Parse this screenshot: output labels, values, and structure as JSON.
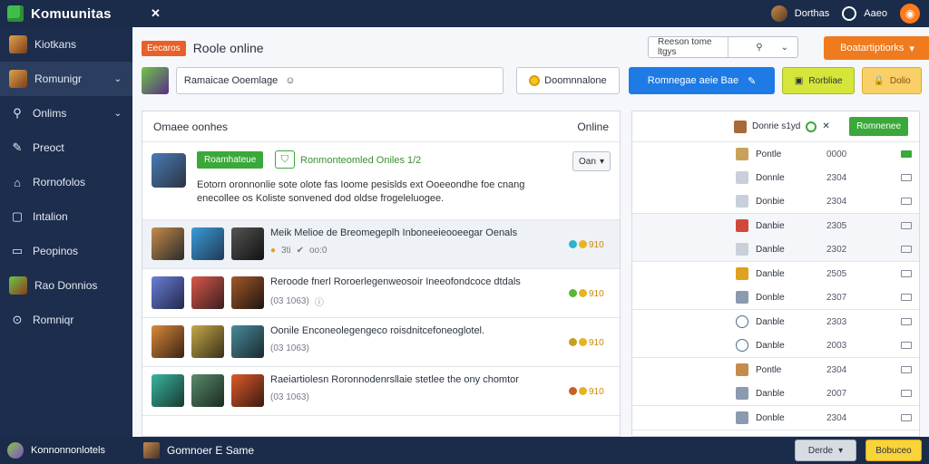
{
  "topbar": {
    "title": "Komuunitas",
    "user1": "Dorthas",
    "user2": "Aaeo",
    "close_icon": "close-icon",
    "notify_icon": "bell-icon"
  },
  "sidebar": {
    "items": [
      {
        "label": "Kiotkans",
        "icon": "avatar-thumb"
      },
      {
        "label": "Romunigr",
        "icon": "avatar-thumb",
        "active": true,
        "chev": "⌄"
      },
      {
        "label": "Onlims",
        "icon": "search-icon",
        "chev": "⌄"
      },
      {
        "label": "Preoct",
        "icon": "edit-icon"
      },
      {
        "label": "Rornofolos",
        "icon": "home-icon"
      },
      {
        "label": "Intalion",
        "icon": "square-icon"
      },
      {
        "label": "Peopinos",
        "icon": "chat-icon"
      },
      {
        "label": "Rao Donnios",
        "icon": "avatar-thumb"
      },
      {
        "label": "Romniqr",
        "icon": "settings-icon"
      }
    ]
  },
  "header": {
    "tag": "Eecaros",
    "title": "Roole online",
    "search_text": "Reeson tome ltgys",
    "search_icon": "search-icon",
    "action_button": "Boatartiptiorks"
  },
  "toolbar": {
    "input_value": "Ramaicae Ooemlage",
    "coin_button": "Doomnnalone",
    "blue_button": "Romnegae aeie Bae",
    "yg_button": "Rorbliae",
    "y_button": "Dolio"
  },
  "feed": {
    "head_left": "Omaee oonhes",
    "head_right": "Online",
    "post": {
      "tag": "Roamhateue",
      "title": "Ronmonteomled Oniles 1/2",
      "body": "Eotorn oronnonlie sote olote fas Ioome pesislds ext Ooeeondhe foe cnang enecollee os Koliste sonvened dod oldse frogeleluogee.",
      "dropdown": "Oan"
    },
    "threads": [
      {
        "title": "Meik Melioe de Breomegeplh Inboneeieooeegar Oenals",
        "meta": "3ti",
        "meta2": "oo:0",
        "gems": "910",
        "highlight": true
      },
      {
        "title": "Reroode fnerl Roroerlegenweosoir Ineeofondcoce dtdals",
        "meta": "(03 1063)",
        "meta2": "",
        "gems": "910"
      },
      {
        "title": "Oonile Enconeolegengeco roisdnitcefoneoglotel.",
        "meta": "(03 1063)",
        "meta2": "",
        "gems": "910"
      },
      {
        "title": "Raeiartiolesn Roronnodenrsllaie stetlee the ony chomtor",
        "meta": "(03 1063)",
        "meta2": "",
        "gems": "910"
      }
    ]
  },
  "rpanel": {
    "head_label": "Donrie s1yd",
    "head_button": "Romnenee",
    "groups": [
      {
        "rows": [
          {
            "name": "Pontle",
            "value": "0000",
            "on": true
          },
          {
            "name": "Donnle",
            "value": "2304"
          },
          {
            "name": "Donbie",
            "value": "2304"
          }
        ]
      },
      {
        "rows": [
          {
            "name": "Danbie",
            "value": "2305"
          },
          {
            "name": "Danble",
            "value": "2302"
          }
        ],
        "highlight": true
      },
      {
        "rows": [
          {
            "name": "Danble",
            "value": "2505"
          },
          {
            "name": "Donble",
            "value": "2307"
          }
        ]
      },
      {
        "rows": [
          {
            "name": "Danble",
            "value": "2303"
          },
          {
            "name": "Danble",
            "value": "2003"
          }
        ]
      },
      {
        "rows": [
          {
            "name": "Pontle",
            "value": "2304"
          },
          {
            "name": "Danble",
            "value": "2007"
          }
        ]
      },
      {
        "rows": [
          {
            "name": "Donble",
            "value": "2304"
          }
        ]
      }
    ]
  },
  "bottombar": {
    "left": "Konnonnonlotels",
    "mid": "Gomnoer E Same",
    "btn1": "Derde",
    "btn2": "Bobuceo"
  },
  "colors": {
    "nav": "#1b2b4a",
    "accent_orange": "#f07a1e",
    "accent_blue": "#1e7be6",
    "accent_green": "#3aa83a"
  }
}
